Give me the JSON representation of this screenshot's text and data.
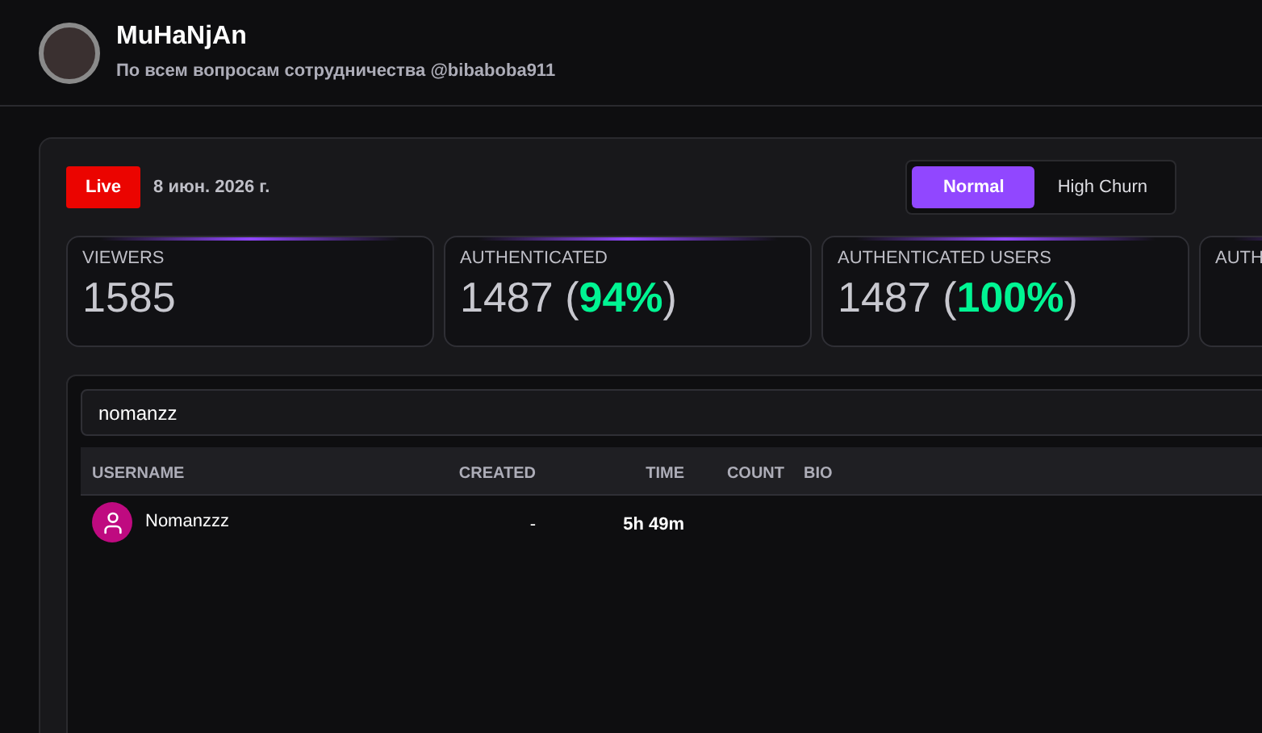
{
  "channel": {
    "name": "MuHaNjAn",
    "description": "По всем вопросам сотрудничества @bibaboba911"
  },
  "status": {
    "badge": "Live",
    "date": "8 июн. 2026 г."
  },
  "mode_toggle": [
    {
      "label": "Normal",
      "selected": true
    },
    {
      "label": "High Churn",
      "selected": false
    }
  ],
  "stats": [
    {
      "label": "VIEWERS",
      "value_parts": [
        {
          "text": "1585",
          "highlight": false
        }
      ]
    },
    {
      "label": "AUTHENTICATED",
      "value_parts": [
        {
          "text": "1487 (",
          "highlight": false
        },
        {
          "text": "94%",
          "highlight": true
        },
        {
          "text": ")",
          "highlight": false
        }
      ]
    },
    {
      "label": "AUTHENTICATED USERS",
      "value_parts": [
        {
          "text": "1487 (",
          "highlight": false
        },
        {
          "text": "100%",
          "highlight": true
        },
        {
          "text": ")",
          "highlight": false
        }
      ]
    },
    {
      "label": "AUTH"
    }
  ],
  "search": {
    "value": "nomanzz"
  },
  "table": {
    "columns": [
      "USERNAME",
      "CREATED",
      "TIME",
      "COUNT",
      "BIO"
    ],
    "rows": [
      {
        "username": "Nomanzzz",
        "created": "-",
        "time": "5h 49m"
      }
    ]
  }
}
